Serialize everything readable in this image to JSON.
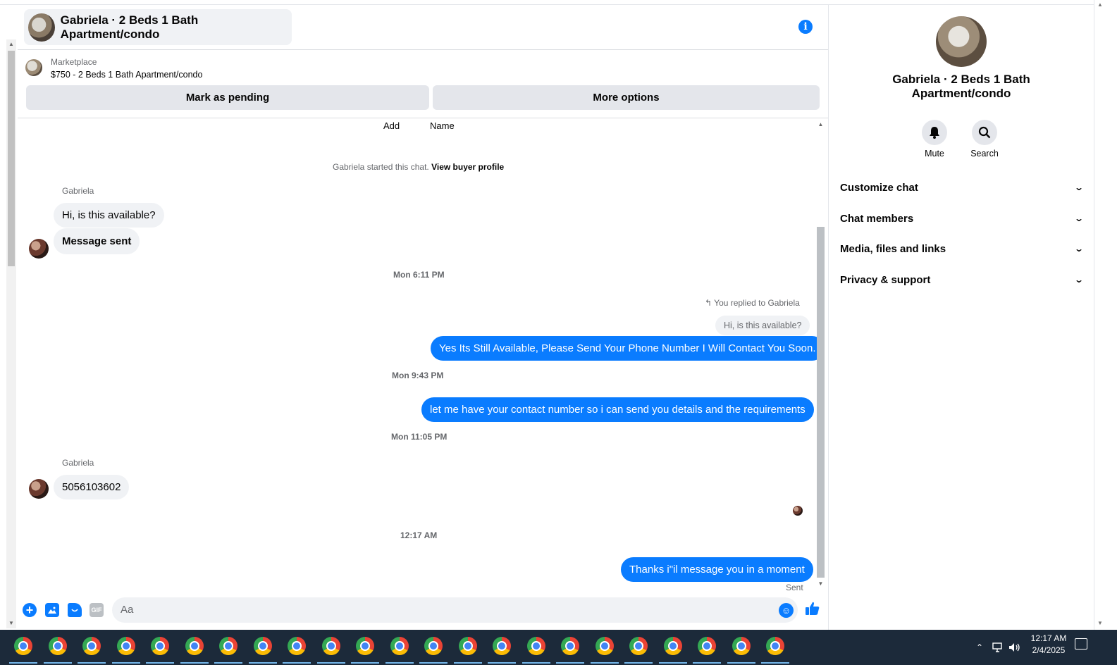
{
  "header": {
    "title": "Gabriela · 2 Beds 1 Bath Apartment/condo"
  },
  "marketplace": {
    "label": "Marketplace",
    "listing": "$750 - 2 Beds 1 Bath Apartment/condo",
    "pending_button": "Mark as pending",
    "more_button": "More options"
  },
  "messages": {
    "top_labels": [
      "Add",
      "Name"
    ],
    "started_prefix": "Gabriela started this chat.",
    "view_profile": "View buyer profile",
    "sender_name": "Gabriela",
    "msg1": "Hi, is this available?",
    "msg2": "Message sent",
    "ts1": "Mon 6:11 PM",
    "reply_note": "You replied to Gabriela",
    "reply_quote": "Hi, is this available?",
    "out1": "Yes Its Still Available, Please Send Your Phone Number I Will Contact You Soon.",
    "ts2": "Mon 9:43 PM",
    "out2": "let me have your contact number so i can send you details and the requirements",
    "ts3": "Mon 11:05 PM",
    "msg3": "5056103602",
    "ts4": "12:17 AM",
    "out3": "Thanks i\"il message you in a moment",
    "status": "Sent"
  },
  "composer": {
    "placeholder": "Aa",
    "gif_label": "GIF"
  },
  "side": {
    "title": "Gabriela · 2 Beds 1 Bath Apartment/condo",
    "mute": "Mute",
    "search": "Search",
    "rows": [
      "Customize chat",
      "Chat members",
      "Media, files and links",
      "Privacy & support"
    ]
  },
  "taskbar": {
    "time": "12:17 AM",
    "date": "2/4/2025"
  },
  "colors": {
    "accent": "#0a7cff",
    "bubble_in": "#f0f2f5",
    "taskbar": "#1c2a3a"
  }
}
